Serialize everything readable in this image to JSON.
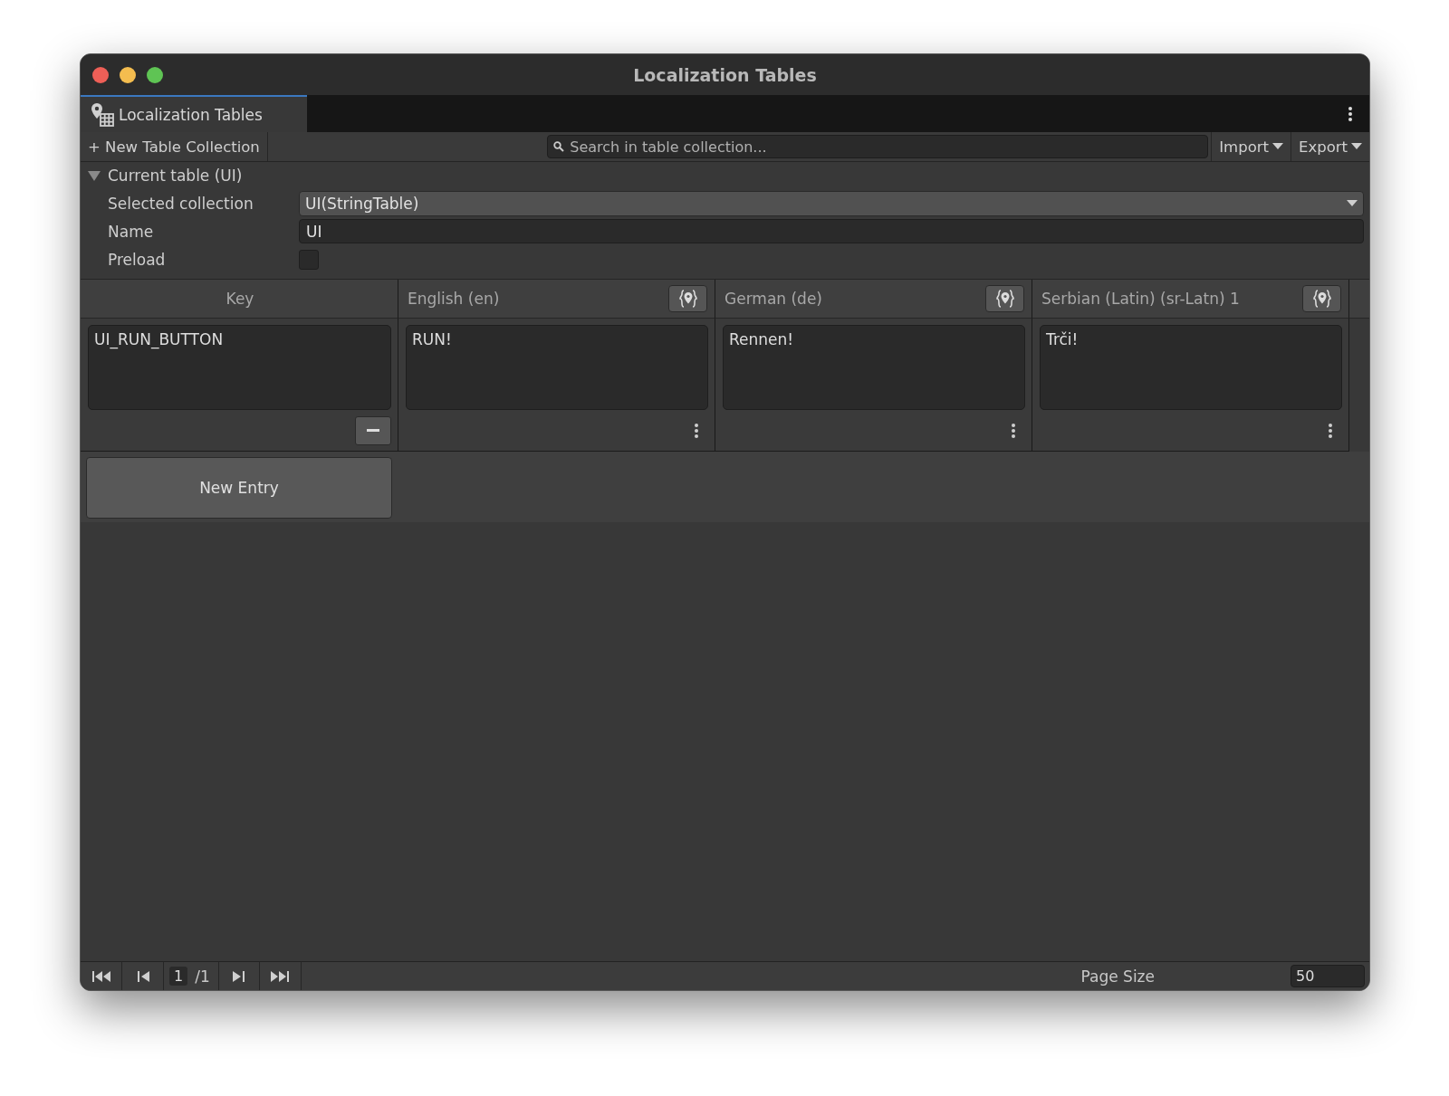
{
  "window": {
    "title": "Localization Tables"
  },
  "tab": {
    "label": "Localization Tables",
    "selected": true
  },
  "toolbar": {
    "new_button": "+ New Table Collection",
    "search": {
      "placeholder": "Search in table collection..."
    },
    "import": "Import",
    "export": "Export"
  },
  "foldout": {
    "label": "Current table (UI)",
    "expanded": true
  },
  "fields": [
    {
      "kind": "dropdown",
      "label": "Selected collection",
      "value": "UI(StringTable)"
    },
    {
      "kind": "text",
      "label": "Name",
      "value": "UI"
    },
    {
      "kind": "checkbox",
      "label": "Preload",
      "checked": false
    }
  ],
  "table": {
    "columns": [
      {
        "label": "Key",
        "kind": "key"
      },
      {
        "label": "English (en)",
        "kind": "locale"
      },
      {
        "label": "German (de)",
        "kind": "locale"
      },
      {
        "label": "Serbian (Latin) (sr-Latn) 1",
        "kind": "locale"
      }
    ],
    "rows": [
      {
        "cells": [
          "UI_RUN_BUTTON",
          "RUN!",
          "Rennen!",
          "Trči!"
        ]
      }
    ]
  },
  "new_entry": "New Entry",
  "pager": {
    "page": "1",
    "total": "/1",
    "page_size_label": "Page Size",
    "page_size": "50"
  }
}
